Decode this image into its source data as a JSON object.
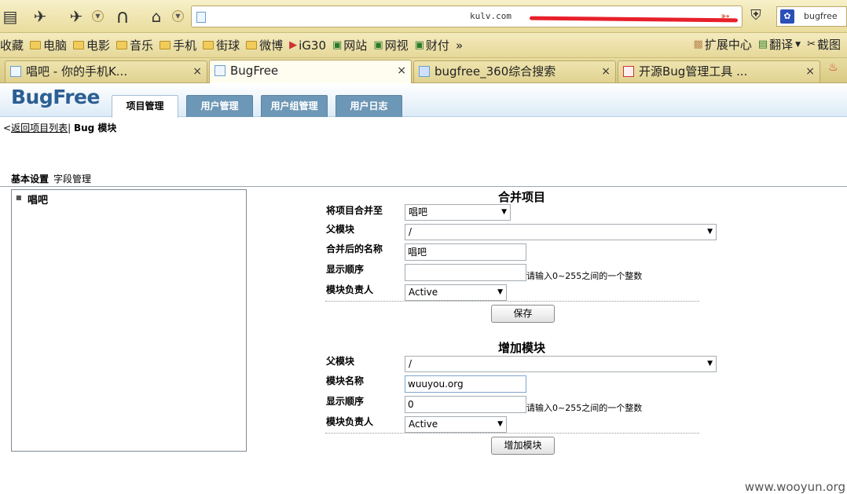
{
  "browser": {
    "address": {
      "url_visible": "kulv.com"
    },
    "search": {
      "engine_text": "bugfree"
    },
    "bookmarks": [
      {
        "label": "收藏",
        "icon": "star-icon"
      },
      {
        "label": "电脑",
        "icon": "folder-icon"
      },
      {
        "label": "电影",
        "icon": "folder-icon"
      },
      {
        "label": "音乐",
        "icon": "folder-icon"
      },
      {
        "label": "手机",
        "icon": "folder-icon"
      },
      {
        "label": "街球",
        "icon": "folder-icon"
      },
      {
        "label": "微博",
        "icon": "folder-icon"
      },
      {
        "label": "iG30",
        "icon": "play-icon"
      },
      {
        "label": "网站",
        "icon": "page-icon"
      },
      {
        "label": "网视",
        "icon": "page-icon"
      },
      {
        "label": "财付",
        "icon": "page-icon"
      },
      {
        "label": "»",
        "icon": ""
      }
    ],
    "bookmarks_right": [
      {
        "label": "扩展中心",
        "icon": "cube-icon"
      },
      {
        "label": "翻译",
        "icon": "translate-icon"
      },
      {
        "label": "截图",
        "icon": "scissors-icon"
      }
    ],
    "tabs": [
      {
        "label": "唱吧 - 你的手机K...",
        "close": "×"
      },
      {
        "label": "BugFree",
        "close": "×"
      },
      {
        "label": "bugfree_360综合搜索",
        "close": "×"
      },
      {
        "label": "开源Bug管理工具 ...",
        "close": "×"
      }
    ]
  },
  "app": {
    "logo": "BugFree",
    "nav_tabs": [
      "项目管理",
      "用户管理",
      "用户组管理",
      "用户日志"
    ],
    "breadcrumb": {
      "prefix": "<",
      "back_link": "返回项目列表",
      "separator": "|",
      "current": "Bug 模块"
    },
    "subnav": {
      "basic": "基本设置",
      "fields": "字段管理"
    },
    "tree": {
      "node": "唱吧"
    },
    "merge": {
      "title": "合并项目",
      "merge_to_label": "将项目合并至",
      "merge_to_value": "唱吧",
      "parent_label": "父模块",
      "parent_value": "/",
      "name_label": "合并后的名称",
      "name_value": "唱吧",
      "order_label": "显示顺序",
      "order_value": "",
      "order_hint": "请输入0~255之间的一个整数",
      "owner_label": "模块负责人",
      "owner_value": "Active",
      "save_button": "保存"
    },
    "add": {
      "title": "增加模块",
      "parent_label": "父模块",
      "parent_value": "/",
      "name_label": "模块名称",
      "name_value": "wuuyou.org",
      "order_label": "显示顺序",
      "order_value": "0",
      "order_hint": "请输入0~255之间的一个整数",
      "owner_label": "模块负责人",
      "owner_value": "Active",
      "add_button": "增加模块"
    }
  },
  "watermark": "www.wooyun.org"
}
